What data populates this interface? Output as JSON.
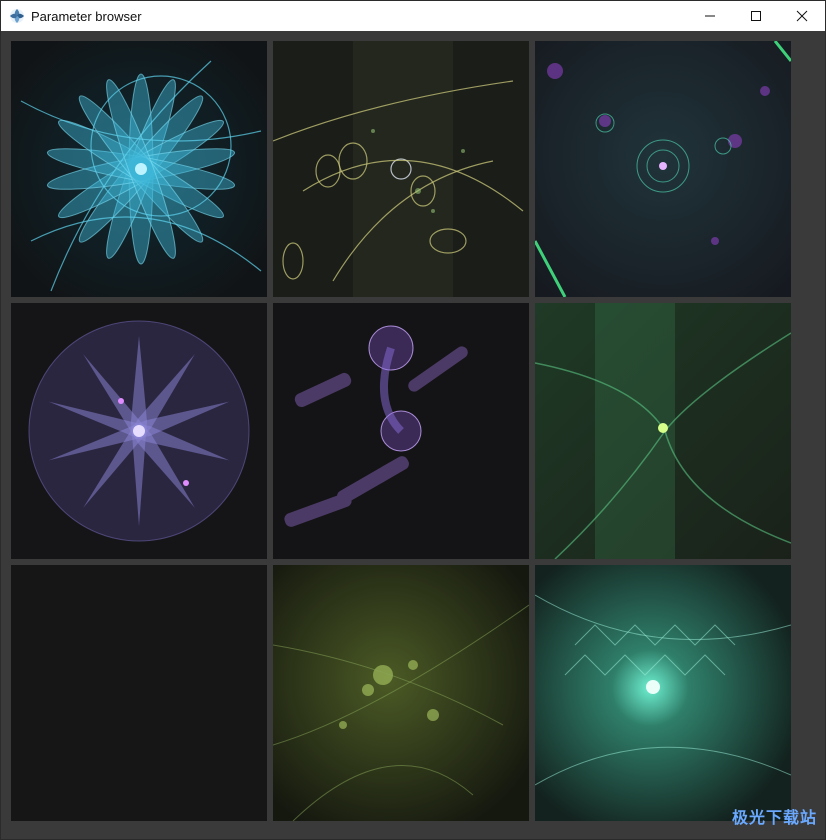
{
  "window": {
    "title": "Parameter browser",
    "controls": {
      "minimize": "minimize-icon",
      "maximize": "maximize-icon",
      "close": "close-icon"
    }
  },
  "thumbnails": [
    {
      "label": "fractal-flame-1",
      "palette": "cyan"
    },
    {
      "label": "fractal-flame-2",
      "palette": "olive"
    },
    {
      "label": "fractal-flame-3",
      "palette": "teal-violet"
    },
    {
      "label": "fractal-flame-4",
      "palette": "lavender"
    },
    {
      "label": "fractal-flame-5",
      "palette": "purple"
    },
    {
      "label": "fractal-flame-6",
      "palette": "green"
    },
    {
      "label": "fractal-flame-7",
      "palette": "empty"
    },
    {
      "label": "fractal-flame-8",
      "palette": "moss"
    },
    {
      "label": "fractal-flame-9",
      "palette": "aqua"
    }
  ],
  "colors": {
    "background": "#3a3a3a",
    "titlebar": "#ffffff",
    "cell_empty": "#161616"
  },
  "watermark": {
    "text": "极光下载站",
    "url": "www.xz7.com"
  }
}
